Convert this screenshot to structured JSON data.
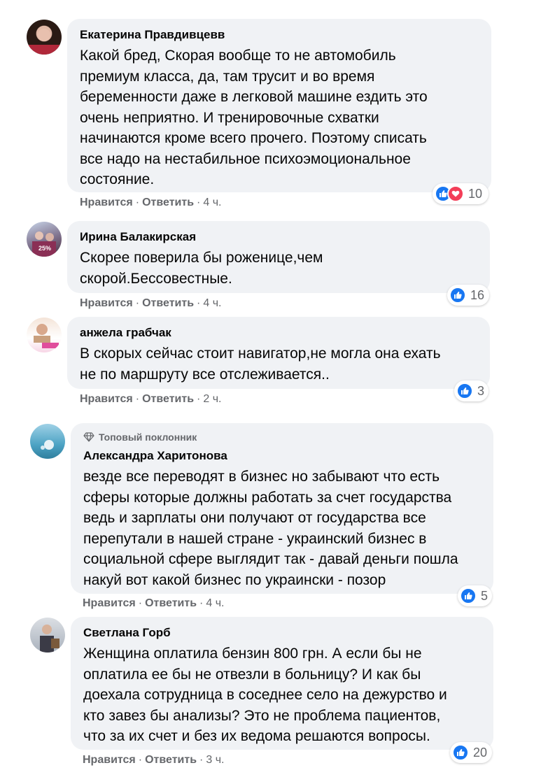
{
  "theme": {
    "bubble_bg": "#f0f2f5",
    "meta_text": "#65676b",
    "like_blue": "#1877f2",
    "love_red": "#f33e58"
  },
  "comments": [
    {
      "author": "Екатерина Правдивцевв",
      "text": "Какой бред, Скорая вообще то не автомобиль\nпремиум класса, да, там трусит и во время\nбеременности даже в легковой машине ездить это\nочень неприятно. И тренировочные схватки\nначинаются кроме всего прочего. Поэтому списать\nвсе надо на нестабильное психоэмоциональное\nсостояние.",
      "like_label": "Нравится",
      "reply_label": "Ответить",
      "time": "4 ч.",
      "reaction_count": "10",
      "reactions": [
        "like-icon",
        "love-icon"
      ]
    },
    {
      "author": "Ирина Балакирская",
      "text": "Скорее поверила бы роженице,чем\nскорой.Бессовестные.",
      "like_label": "Нравится",
      "reply_label": "Ответить",
      "time": "4 ч.",
      "reaction_count": "16",
      "reactions": [
        "like-icon"
      ],
      "avatar_badge": "25%"
    },
    {
      "author": "анжела грабчак",
      "text": "В скорых сейчас стоит навигатор,не могла она ехать\nне по маршруту все отслеживается..",
      "like_label": "Нравится",
      "reply_label": "Ответить",
      "time": "2 ч.",
      "reaction_count": "3",
      "reactions": [
        "like-icon"
      ]
    },
    {
      "badge": "Топовый поклонник",
      "author": "Александра Харитонова",
      "text": "везде все переводят в бизнес но забывают что есть\nсферы которые должны работать за счет государства\nведь и зарплаты они получают от государства все\nперепутали в нашей стране - украинский бизнес в\nсоциальной сфере выглядит так - давай деньги пошла\nнакуй вот какой бизнес по украински - позор",
      "like_label": "Нравится",
      "reply_label": "Ответить",
      "time": "4 ч.",
      "reaction_count": "5",
      "reactions": [
        "like-icon"
      ]
    },
    {
      "author": "Светлана Горб",
      "text": "Женщина оплатила бензин 800 грн. А если бы не\nоплатила ее бы не отвезли в больницу? И как бы\nдоехала сотрудница в соседнее село на дежурство и\nкто завез бы анализы? Это не проблема пациентов,\nчто за их счет и без их ведома решаются вопросы.",
      "like_label": "Нравится",
      "reply_label": "Ответить",
      "time": "3 ч.",
      "reaction_count": "20",
      "reactions": [
        "like-icon"
      ]
    }
  ],
  "separator": "·"
}
